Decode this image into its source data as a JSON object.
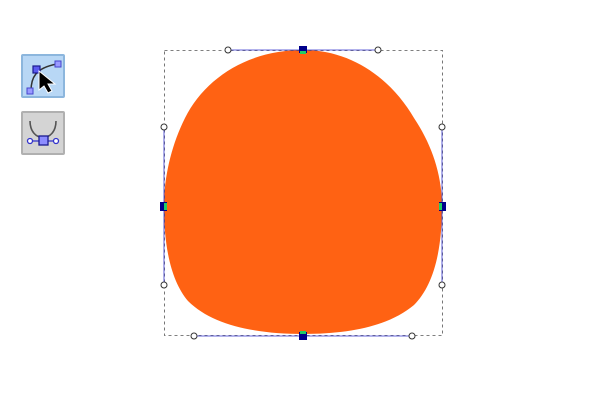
{
  "toolbar": {
    "tools": [
      {
        "id": "node-edit",
        "icon": "node-edit-icon",
        "active": true
      },
      {
        "id": "bezier-handle",
        "icon": "bezier-handle-icon",
        "active": false
      }
    ]
  },
  "canvas": {
    "shape": {
      "name": "rounded-blob",
      "fill_color": "#ff6213"
    },
    "selection": {
      "bbox_style": "dashed",
      "node_color": "#00008b",
      "node_highlight_color": "#22cc66",
      "path_outline_color": "#3333cc"
    }
  }
}
